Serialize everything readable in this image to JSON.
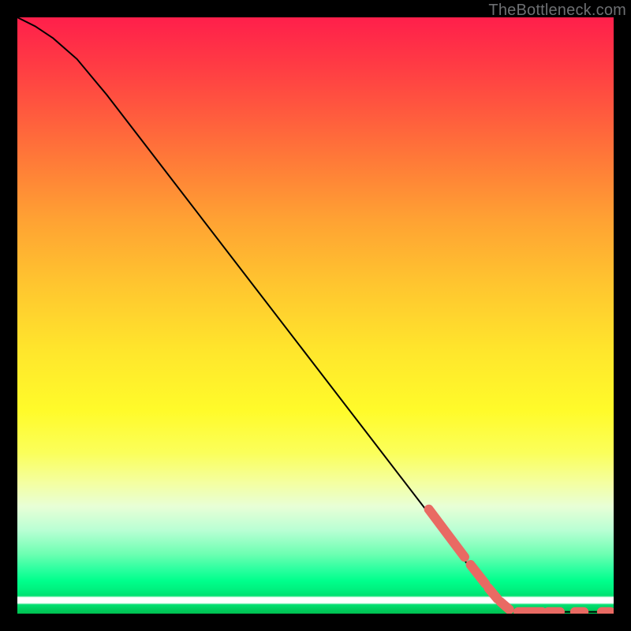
{
  "attribution": "TheBottleneck.com",
  "chart_data": {
    "type": "line",
    "title": "",
    "xlabel": "",
    "ylabel": "",
    "xlim": [
      0,
      100
    ],
    "ylim": [
      0,
      100
    ],
    "grid": false,
    "legend": false,
    "curve": [
      {
        "x": 0,
        "y": 100
      },
      {
        "x": 3,
        "y": 98.5
      },
      {
        "x": 6,
        "y": 96.5
      },
      {
        "x": 10,
        "y": 93
      },
      {
        "x": 15,
        "y": 87
      },
      {
        "x": 20,
        "y": 80.5
      },
      {
        "x": 30,
        "y": 67.5
      },
      {
        "x": 40,
        "y": 54.5
      },
      {
        "x": 50,
        "y": 41.5
      },
      {
        "x": 60,
        "y": 28.5
      },
      {
        "x": 70,
        "y": 15.5
      },
      {
        "x": 78,
        "y": 5
      },
      {
        "x": 82,
        "y": 1
      },
      {
        "x": 84,
        "y": 0.3
      },
      {
        "x": 100,
        "y": 0.3
      }
    ],
    "marker_clusters_diagonal": [
      {
        "x_start": 69,
        "x_end": 75,
        "y_start": 17.5,
        "y_end": 9.5
      },
      {
        "x_start": 76,
        "x_end": 78.5,
        "y_start": 8.2,
        "y_end": 5.0
      },
      {
        "x_start": 79,
        "x_end": 80.5,
        "y_start": 4.3,
        "y_end": 2.5
      },
      {
        "x_start": 81,
        "x_end": 82.5,
        "y_start": 2.0,
        "y_end": 0.7
      }
    ],
    "marker_clusters_flat": [
      {
        "x_start": 84,
        "x_end": 88,
        "y": 0.3
      },
      {
        "x_start": 89,
        "x_end": 91,
        "y": 0.3
      },
      {
        "x_start": 93.5,
        "x_end": 95,
        "y": 0.3
      },
      {
        "x_start": 98,
        "x_end": 99.5,
        "y": 0.3
      }
    ],
    "colors": {
      "curve": "#000000",
      "marker_fill": "#e96a63",
      "marker_stroke": "#d8544e"
    }
  }
}
